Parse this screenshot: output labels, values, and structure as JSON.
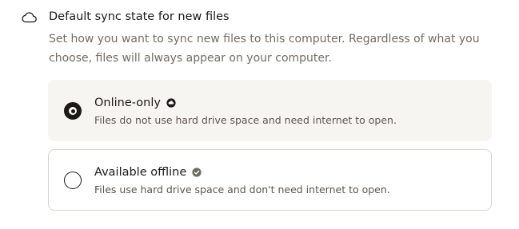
{
  "section": {
    "icon": "cloud-icon",
    "title": "Default sync state for new files",
    "description": "Set how you want to sync new files to this computer. Regardless of what you choose, files will always appear on your computer."
  },
  "options": [
    {
      "label": "Online-only",
      "description": "Files do not use hard drive space and need internet to open.",
      "icon": "online-only-cloud-icon",
      "selected": true
    },
    {
      "label": "Available offline",
      "description": "Files use hard drive space and don't need internet to open.",
      "icon": "available-offline-check-icon",
      "selected": false
    }
  ],
  "colors": {
    "text": "#1e1919",
    "muted": "#736c64",
    "selected_bg": "#f7f5f2",
    "border": "#d9d4ce",
    "check_icon": "#6f6a64"
  }
}
